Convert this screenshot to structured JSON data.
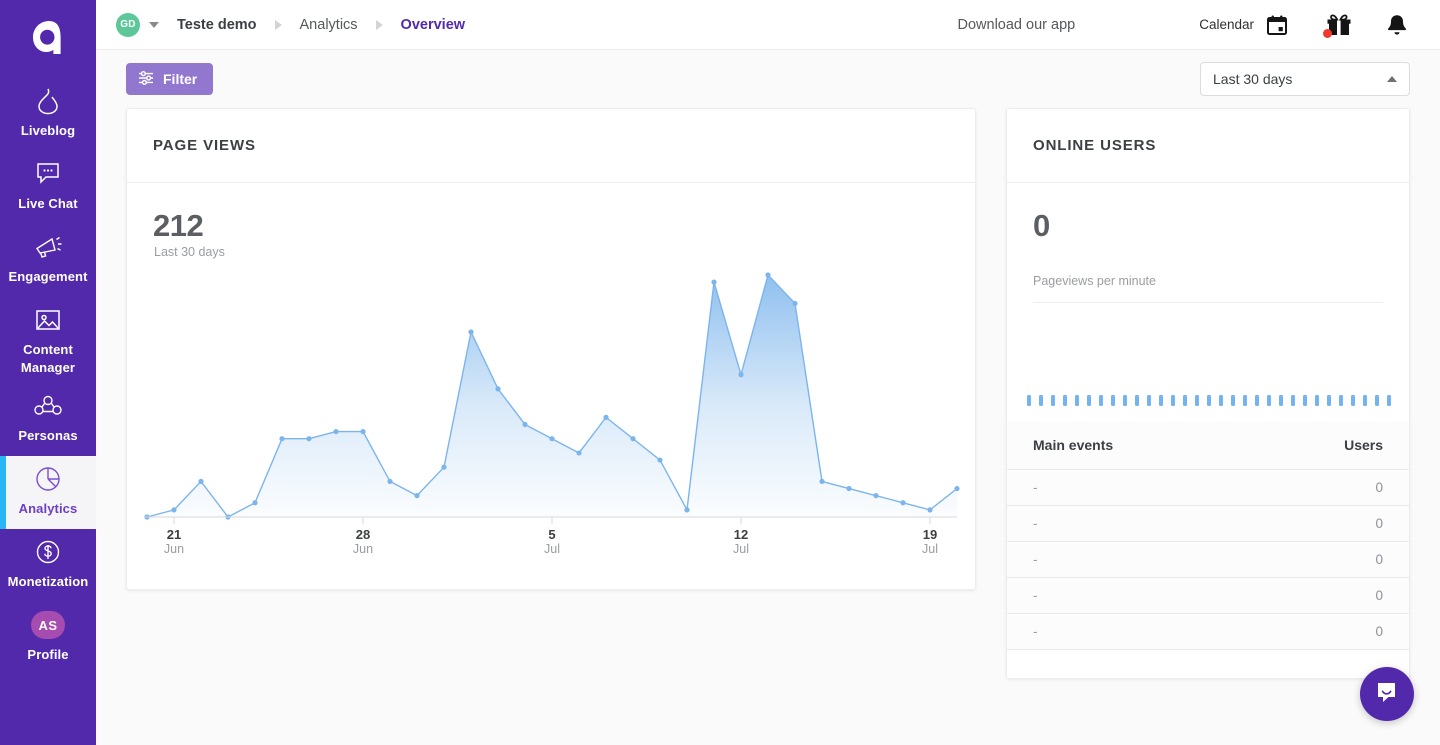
{
  "sidebar": {
    "logo_icon": "apester-a-logo",
    "items": [
      {
        "label": "Liveblog",
        "icon": "flame-icon",
        "active": false
      },
      {
        "label": "Live Chat",
        "icon": "chat-bubble-icon",
        "active": false
      },
      {
        "label": "Engagement",
        "icon": "megaphone-icon",
        "active": false
      },
      {
        "label": "Content Manager",
        "icon": "image-icon",
        "active": false
      },
      {
        "label": "Personas",
        "icon": "personas-icon",
        "active": false
      },
      {
        "label": "Analytics",
        "icon": "pie-chart-icon",
        "active": true
      },
      {
        "label": "Monetization",
        "icon": "dollar-circle-icon",
        "active": false
      },
      {
        "label": "Profile",
        "icon": "avatar-initials",
        "active": false,
        "initials": "AS"
      }
    ]
  },
  "header": {
    "workspace_initials": "GD",
    "workspace_dropdown_icon": "chevron-down-icon",
    "breadcrumbs": [
      {
        "label": "Teste demo",
        "current": false
      },
      {
        "label": "Analytics",
        "current": false
      },
      {
        "label": "Overview",
        "current": true
      }
    ],
    "download_label": "Download our app",
    "calendar_label": "Calendar",
    "calendar_icon": "calendar-icon",
    "gift_icon": "gift-icon",
    "gift_badge": true,
    "bell_icon": "bell-icon"
  },
  "toolbar": {
    "filter_label": "Filter",
    "filter_icon": "sliders-icon",
    "range_value": "Last 30 days",
    "range_caret_icon": "caret-up-icon"
  },
  "page_views": {
    "title": "PAGE VIEWS",
    "value": "212",
    "subtitle": "Last 30 days"
  },
  "online_users": {
    "title": "ONLINE USERS",
    "value": "0",
    "subtitle": "Pageviews per minute",
    "sparkline_bars": 31
  },
  "events_table": {
    "columns": [
      "Main events",
      "Users"
    ],
    "rows": [
      {
        "event": "-",
        "users": "0"
      },
      {
        "event": "-",
        "users": "0"
      },
      {
        "event": "-",
        "users": "0"
      },
      {
        "event": "-",
        "users": "0"
      },
      {
        "event": "-",
        "users": "0"
      }
    ]
  },
  "intercom": {
    "icon": "intercom-chat-icon"
  },
  "colors": {
    "sidebar_bg": "#5329ab",
    "accent_purple": "#9277cf",
    "active_indicator": "#29b6f6",
    "chart_line": "#7cb5ec",
    "badge_red": "#f03a2e",
    "avatar_green": "#5ec79a",
    "avatar_magenta": "#a64bb0"
  },
  "chart_data": {
    "type": "area",
    "title": "Page views",
    "xlabel": "",
    "ylabel": "",
    "grid": false,
    "legend": "none",
    "ylim": [
      0,
      34
    ],
    "line_color": "#7cb5ec",
    "fill": "gradient blue to transparent",
    "tick_labels": [
      {
        "day": "21",
        "month": "Jun",
        "x_index": 1
      },
      {
        "day": "28",
        "month": "Jun",
        "x_index": 8
      },
      {
        "day": "5",
        "month": "Jul",
        "x_index": 15
      },
      {
        "day": "12",
        "month": "Jul",
        "x_index": 22
      },
      {
        "day": "19",
        "month": "Jul",
        "x_index": 29
      }
    ],
    "x": [
      "Jun 20",
      "Jun 21",
      "Jun 22",
      "Jun 23",
      "Jun 24",
      "Jun 25",
      "Jun 26",
      "Jun 27",
      "Jun 28",
      "Jun 29",
      "Jun 30",
      "Jul 1",
      "Jul 2",
      "Jul 3",
      "Jul 4",
      "Jul 5",
      "Jul 6",
      "Jul 7",
      "Jul 8",
      "Jul 9",
      "Jul 10",
      "Jul 11",
      "Jul 12",
      "Jul 13",
      "Jul 14",
      "Jul 15",
      "Jul 16",
      "Jul 17",
      "Jul 18",
      "Jul 19",
      "Jul 20"
    ],
    "values": [
      0,
      1,
      5,
      0,
      2,
      11,
      11,
      12,
      12,
      5,
      3,
      7,
      26,
      18,
      13,
      11,
      9,
      14,
      11,
      8,
      1,
      33,
      20,
      34,
      30,
      5,
      4,
      3,
      2,
      1,
      4
    ],
    "points_marked": true
  }
}
